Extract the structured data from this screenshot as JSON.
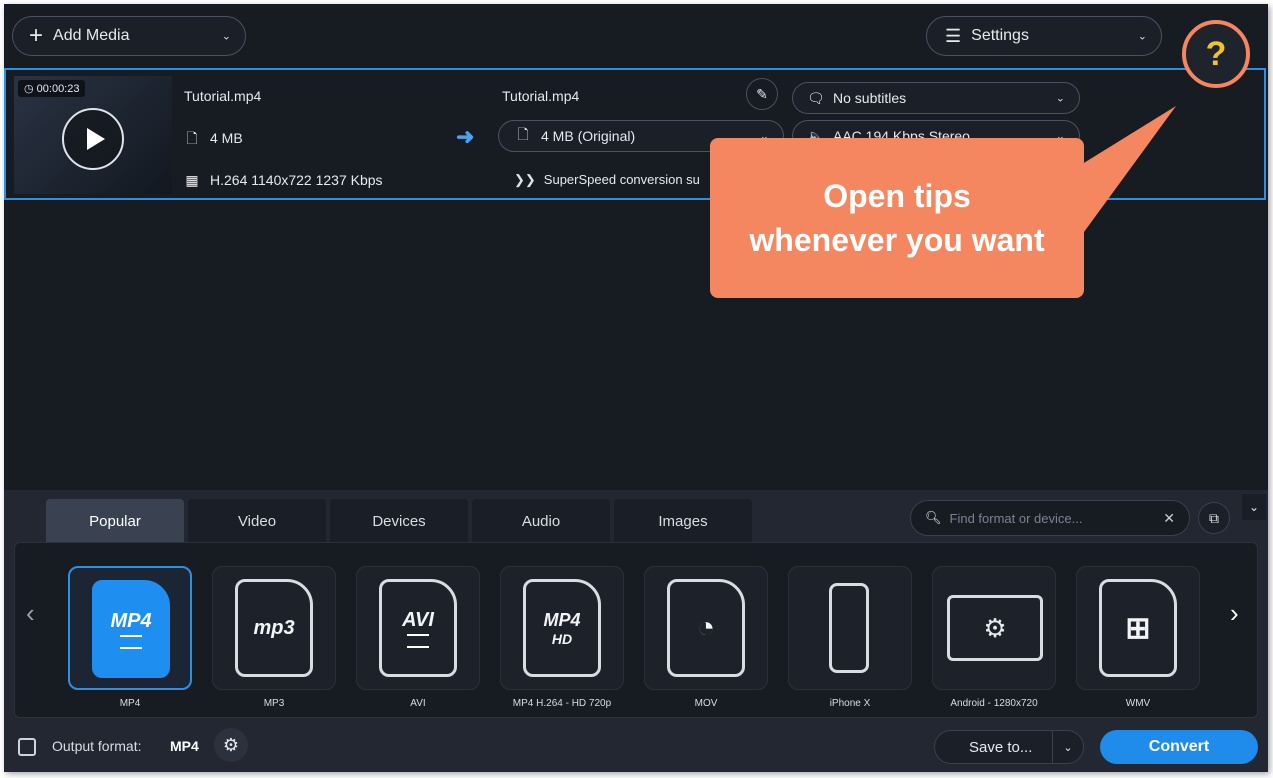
{
  "colors": {
    "accent": "#2f8fe0",
    "callout": "#f4875f",
    "help_icon": "#f2c12e",
    "convert": "#1f8bea"
  },
  "toolbar": {
    "add_media_label": "Add Media",
    "settings_label": "Settings",
    "help_glyph": "?"
  },
  "file": {
    "duration": "00:00:23",
    "source_name": "Tutorial.mp4",
    "source_size": "4 MB",
    "source_codec": "H.264 1140x722 1237 Kbps",
    "output_name": "Tutorial.mp4",
    "output_size": "4 MB (Original)",
    "superspeed": "SuperSpeed conversion su",
    "subtitles": "No subtitles",
    "audio": "AAC 194 Kbps Stereo"
  },
  "callout": {
    "line1": "Open tips",
    "line2": "whenever you want"
  },
  "tabs": [
    {
      "label": "Popular",
      "active": true
    },
    {
      "label": "Video"
    },
    {
      "label": "Devices"
    },
    {
      "label": "Audio"
    },
    {
      "label": "Images"
    }
  ],
  "search": {
    "placeholder": "Find format or device..."
  },
  "formats": [
    {
      "label": "MP4",
      "icon": "mp4-icon",
      "selected": true
    },
    {
      "label": "MP3",
      "icon": "mp3-icon"
    },
    {
      "label": "AVI",
      "icon": "avi-icon"
    },
    {
      "label": "MP4 H.264 - HD 720p",
      "icon": "mp4-hd-icon"
    },
    {
      "label": "MOV",
      "icon": "quicktime-icon"
    },
    {
      "label": "iPhone X",
      "icon": "iphone-icon"
    },
    {
      "label": "Android - 1280x720",
      "icon": "android-icon"
    },
    {
      "label": "WMV",
      "icon": "windows-icon"
    }
  ],
  "footer": {
    "output_label": "Output format:",
    "output_value": "MP4",
    "save_to_label": "Save to...",
    "convert_label": "Convert"
  }
}
